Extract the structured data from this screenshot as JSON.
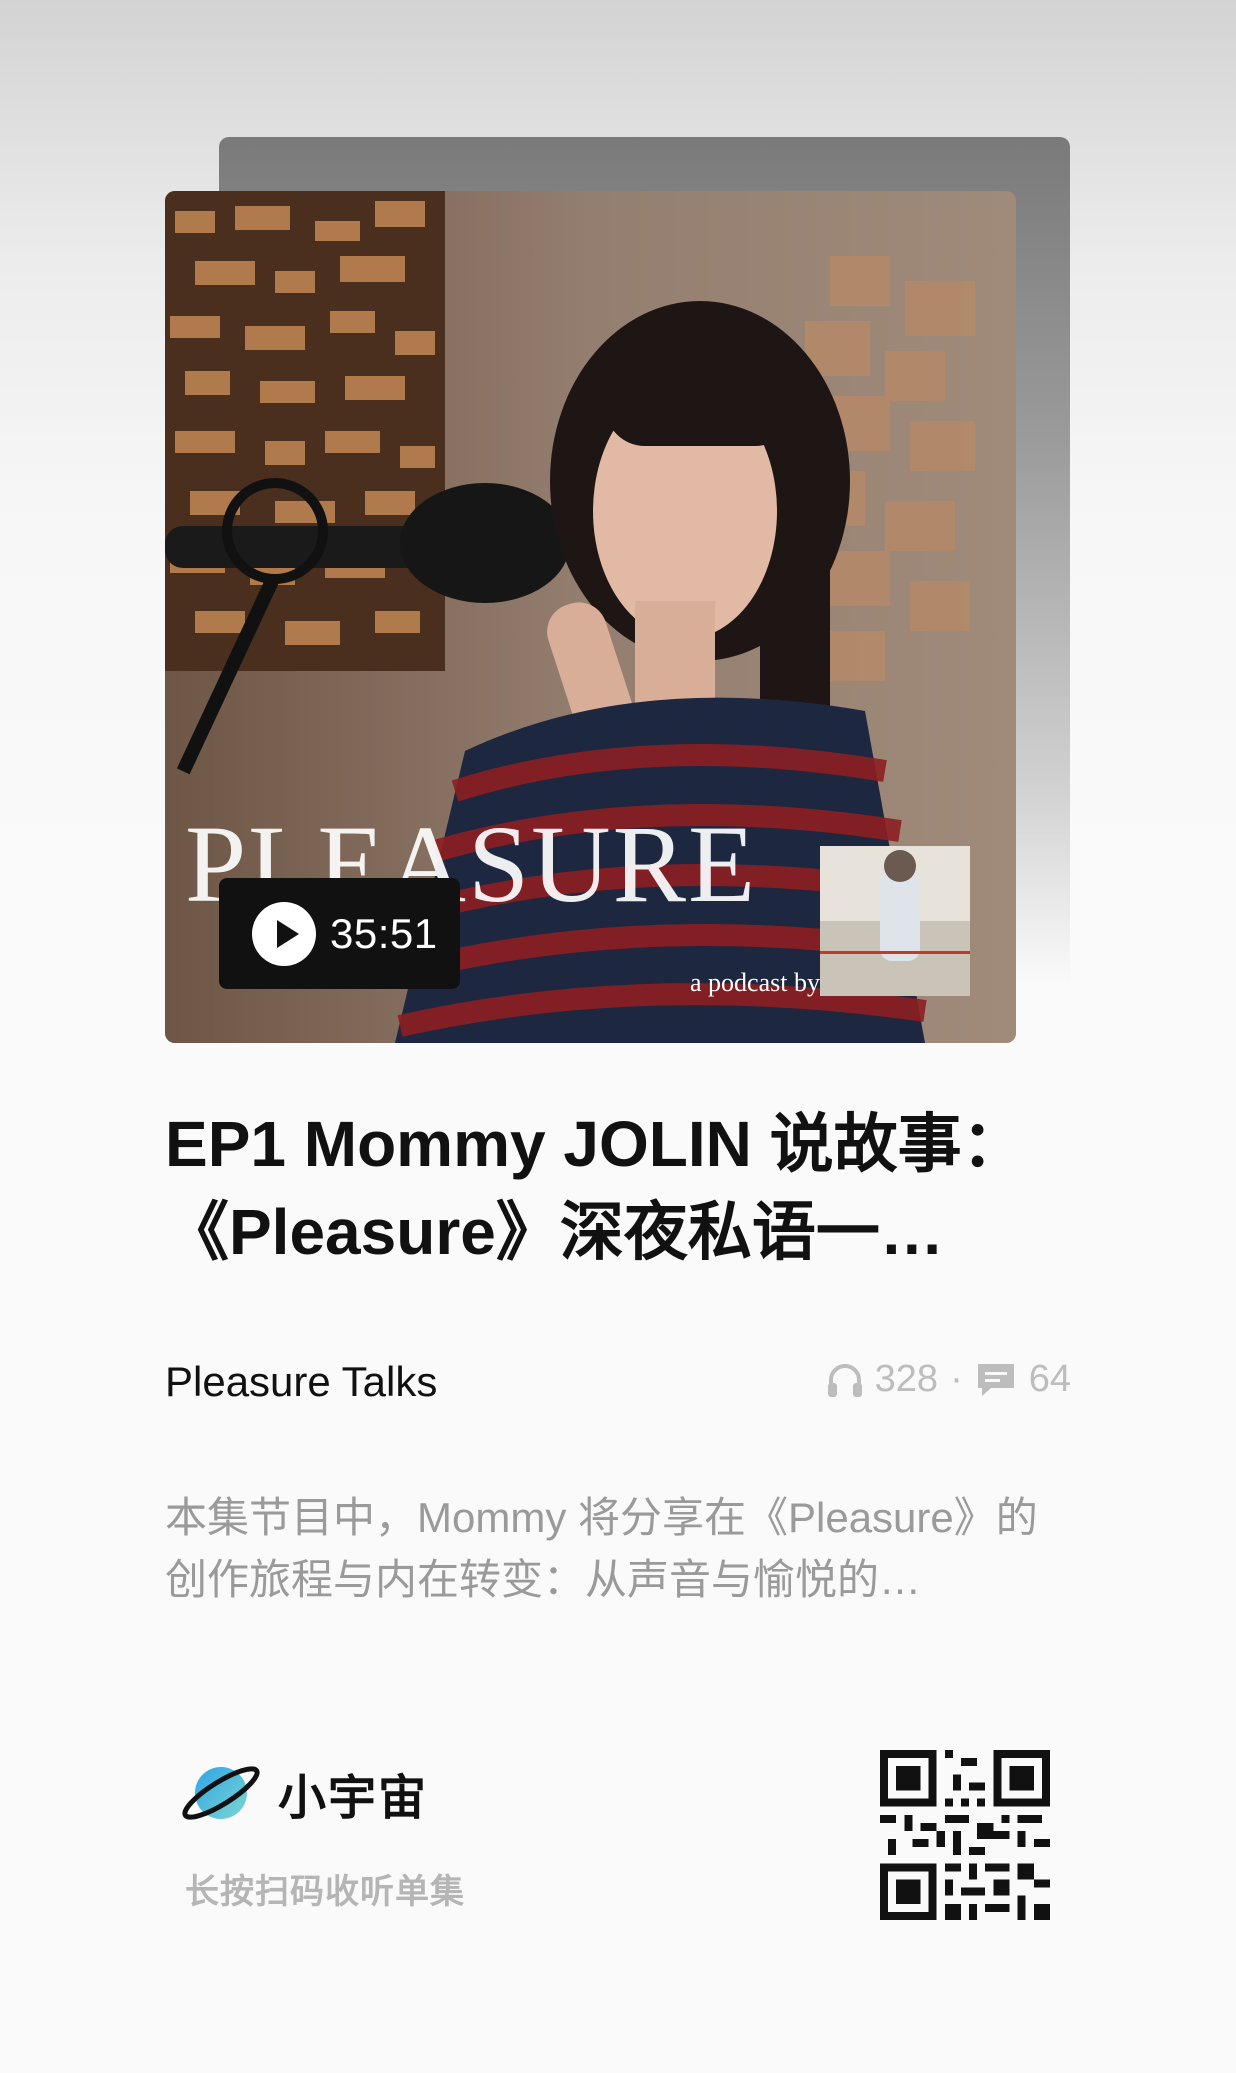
{
  "episode": {
    "title": "EP1 Mommy JOLIN 说故事：《Pleasure》深夜私语一…",
    "duration": "35:51",
    "show_name": "Pleasure Talks",
    "plays": "328",
    "comments": "64",
    "description": "本集节目中，Mommy 将分享在《Pleasure》的创作旅程与内在转变：从声音与愉悦的…"
  },
  "cover": {
    "logo_text": "PLEASURE",
    "sub_text": "a podcast by"
  },
  "brand": {
    "name": "小宇宙",
    "hint": "长按扫码收听单集"
  },
  "icons": {
    "play": "play-icon",
    "plays": "headphones-icon",
    "comments": "comment-icon",
    "logo": "planet-logo-icon",
    "qr": "qr-code-icon"
  }
}
